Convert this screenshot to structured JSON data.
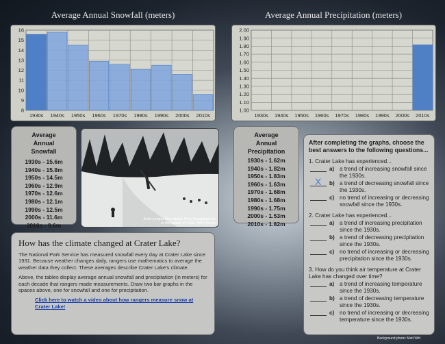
{
  "snow": {
    "title": "Average Annual Snowfall (meters)",
    "table_title": "Average Annual Snowfall",
    "rows": [
      "1930s - 15.6m",
      "1940s - 15.8m",
      "1950s - 14.5m",
      "1960s - 12.9m",
      "1970s - 12.6m",
      "1980s - 12.1m",
      "1990s - 12.5m",
      "2000s - 11.6m",
      "2010s -   9.6m"
    ]
  },
  "precip": {
    "title": "Average Annual Precipitation (meters)",
    "table_title": "Average Annual Precipitation",
    "rows": [
      "1930s - 1.62m",
      "1940s - 1.82m",
      "1950s - 1.83m",
      "1960s - 1.63m",
      "1970s - 1.68m",
      "1980s - 1.68m",
      "1990s - 1.75m",
      "2000s - 1.53m",
      "2010s - 1.82m"
    ]
  },
  "chart_data": [
    {
      "type": "bar",
      "title": "Average Annual Snowfall (meters)",
      "categories": [
        "1930s",
        "1940s",
        "1950s",
        "1960s",
        "1970s",
        "1980s",
        "1990s",
        "2000s",
        "2010s"
      ],
      "values": [
        15.6,
        15.8,
        14.5,
        12.9,
        12.6,
        12.1,
        12.5,
        11.6,
        9.6
      ],
      "ylim": [
        8,
        16
      ],
      "yticks": [
        "8",
        "9",
        "10",
        "11",
        "12",
        "13",
        "14",
        "15",
        "16"
      ],
      "grid": true
    },
    {
      "type": "bar",
      "title": "Average Annual Precipitation (meters)",
      "categories": [
        "1930s",
        "1940s",
        "1950s",
        "1960s",
        "1970s",
        "1980s",
        "1990s",
        "2000s",
        "2010s"
      ],
      "values": [
        null,
        null,
        null,
        null,
        null,
        null,
        null,
        null,
        1.82
      ],
      "ylim": [
        1.0,
        2.0
      ],
      "yticks": [
        "1.00",
        "1.10",
        "1.20",
        "1.30",
        "1.40",
        "1.50",
        "1.60",
        "1.70",
        "1.80",
        "1.90",
        "2.00"
      ],
      "grid": true
    }
  ],
  "photo": {
    "caption_line1": "A ski jumper flies above Park Headquarters",
    "caption_line2": "in the winter of 1932. NPS Photo"
  },
  "info": {
    "heading": "How has the climate changed at Crater Lake?",
    "para1": "The National Park Service has measured snowfall every day at Crater Lake since 1931. Because weather changes daily, rangers use mathematics to average the weather data they collect. These averages describe Crater Lake's climate.",
    "para2": "Above, the tables display average annual snowfall and precipitation (in meters) for each decade that rangers made measurements. Draw two bar graphs in the spaces above, one for snowfall and one for precipitation.",
    "link": "Click here to watch a video about how rangers measure snow at Crater Lake!"
  },
  "questions": {
    "heading": "After completing the graphs, choose the best answers to the following questions...",
    "q1": "1. Crater Lake has experienced...",
    "q1a": "a trend of increasing snowfall since the 1930s.",
    "q1b": "a trend of decreasing snowfall since the 1930s.",
    "q1c": "no trend of increasing or decreasing snowfall since the 1930s.",
    "q2": "2. Crater Lake has experienced...",
    "q2a": "a trend of increasing precipitation since the 1930s.",
    "q2b": "a trend of decreasing precipitation since the 1930s.",
    "q2c": "no trend of increasing or decreasing precipitation since the 1930s.",
    "q3": "3. How do you think air temperature at Crater Lake has changed over time?",
    "q3a": "a trend of increasing temperature since the 1930s.",
    "q3b": "a trend of decreasing temperature since the 1930s.",
    "q3c": "no trend of increasing or decreasing temperature since the 1930s.",
    "letter_a": "a)",
    "letter_b": "b)",
    "letter_c": "c)",
    "answer_mark": "X"
  },
  "credit": "Background photo: Matt Witt",
  "colors": {
    "bar": "#4f7fc4",
    "bar_hand": "#7fa6dd",
    "mark": "#4a7fd0"
  }
}
